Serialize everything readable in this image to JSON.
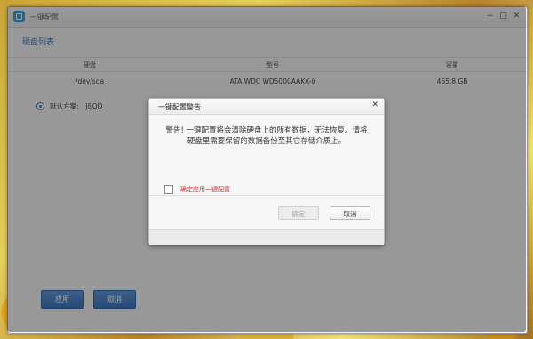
{
  "window": {
    "title": "一键配置",
    "controls": [
      "−",
      "□",
      "✕"
    ]
  },
  "disk_list": {
    "title": "硬盘列表",
    "columns": [
      "硬盘",
      "型号",
      "容量"
    ],
    "rows": [
      [
        "/dev/sda",
        "ATA WDC WD5000AAKX-0",
        "465.8 GB"
      ]
    ]
  },
  "default_plan": {
    "label": "默认方案:",
    "value": "JBOD"
  },
  "buttons": {
    "apply": "应用",
    "cancel": "取消"
  },
  "dialog": {
    "title": "一键配置警告",
    "close": "✕",
    "message": "警告! 一键配置将会清除硬盘上的所有数据，无法恢复。请将硬盘里需要保留的数据备份至其它存储介质上。",
    "checkbox_label": "确定应用一键配置",
    "confirm_label": "确定",
    "cancel_label": "取消"
  },
  "colors": {
    "accent": "#2a6db0",
    "warning_text": "#e0262b",
    "primary_button": "#2f74c8"
  },
  "icons": {
    "app": "app-icon",
    "minimize": "minimize-icon",
    "maximize": "maximize-icon",
    "close": "close-icon"
  }
}
